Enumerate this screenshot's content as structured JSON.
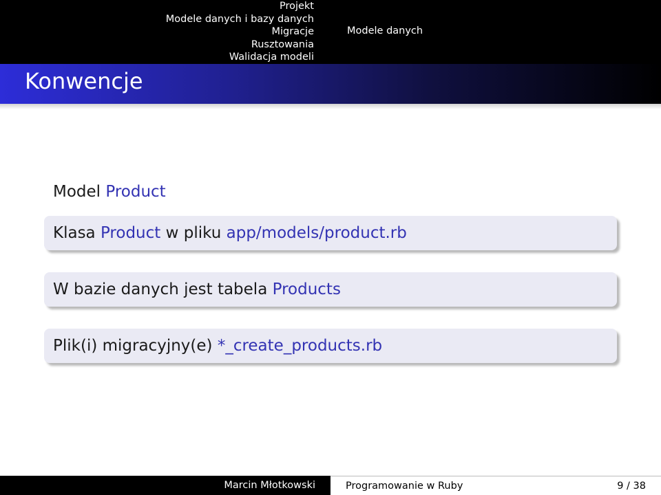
{
  "nav": {
    "sections": [
      "Projekt",
      "Modele danych i bazy danych",
      "Migracje",
      "Rusztowania",
      "Walidacja modeli"
    ],
    "current_subsection": "Modele danych"
  },
  "frame": {
    "title": "Konwencje"
  },
  "content": {
    "heading": {
      "plain": "Model ",
      "accent": "Product"
    },
    "box1": {
      "p1": "Klasa ",
      "a1": "Product",
      "p2": " w pliku ",
      "a2": "app/models/product.rb"
    },
    "box2": {
      "p1": "W bazie danych jest tabela ",
      "a1": "Products"
    },
    "box3": {
      "p1": "Plik(i) migracyjny(e) ",
      "a1": "*_create_products.rb"
    }
  },
  "footer": {
    "author": "Marcin Młotkowski",
    "talk_title": "Programowanie w Ruby",
    "page": "9 / 38"
  },
  "colors": {
    "accent": "#3333b3",
    "box_background": "#eaeaf4",
    "title_gradient_start": "#2d2dd8"
  }
}
